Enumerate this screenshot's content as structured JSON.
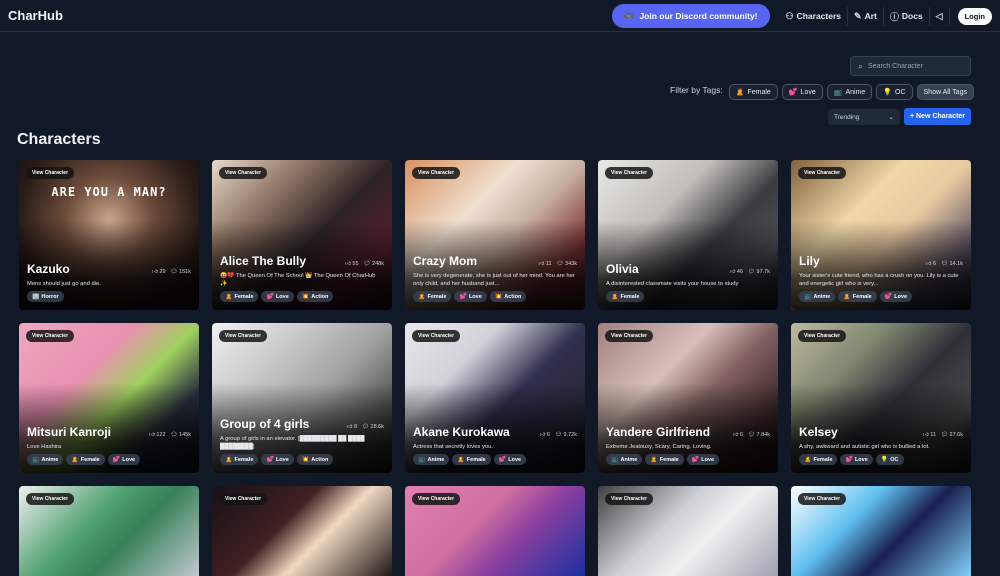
{
  "header": {
    "brand": "CharHub",
    "discord_label": "Join our Discord community!",
    "nav": [
      {
        "label": "Characters",
        "icon": "people-icon"
      },
      {
        "label": "Art",
        "icon": "brush-icon"
      },
      {
        "label": "Docs",
        "icon": "help-circle-icon"
      }
    ],
    "announce_icon": "megaphone-icon",
    "login_label": "Login"
  },
  "search": {
    "placeholder": "Search Character",
    "value": ""
  },
  "filters": {
    "label": "Filter by Tags:",
    "tags": [
      {
        "emoji": "🙎",
        "label": "Female"
      },
      {
        "emoji": "💕",
        "label": "Love"
      },
      {
        "emoji": "📺",
        "label": "Anime"
      },
      {
        "emoji": "💡",
        "label": "OC"
      }
    ],
    "show_all_label": "Show All Tags"
  },
  "sort": {
    "selected": "Trending"
  },
  "new_character_label": "+ New Character",
  "section_title": "Characters",
  "view_label": "View Character",
  "characters": [
    {
      "name": "Kazuko",
      "likes": "29",
      "chats": "151k",
      "overlay": "ARE YOU A MAN?",
      "desc": "Mens should just go and die.",
      "tags": [
        {
          "e": "🏢",
          "t": "Horror"
        }
      ],
      "bg": "radial-gradient(ellipse at 50% 40%, #c9a48a 0%, #6b4a3a 35%, #2a1c18 70%, #120c0a 100%)"
    },
    {
      "name": "Alice The Bully",
      "likes": "55",
      "chats": "248k",
      "desc": "😝💔 The Queen Of The School 👑 The Queen Of CharHub ✨",
      "tags": [
        {
          "e": "🙎",
          "t": "Female"
        },
        {
          "e": "💕",
          "t": "Love"
        },
        {
          "e": "💥",
          "t": "Action"
        }
      ],
      "bg": "linear-gradient(135deg, #e8d8c8 0%, #8a7060 30%, #2b2226 55%, #5a2030 80%, #1a1418 100%)"
    },
    {
      "name": "Crazy Mom",
      "likes": "11",
      "chats": "343k",
      "desc": "She is very degenerate, she is just out of her mind. You are her only child, and her husband just...",
      "tags": [
        {
          "e": "🙎",
          "t": "Female"
        },
        {
          "e": "💕",
          "t": "Love"
        },
        {
          "e": "💥",
          "t": "Action"
        }
      ],
      "bg": "linear-gradient(135deg, #d89060 0%, #f0e0d0 35%, #c8b0a0 55%, #7a3030 80%, #402020 100%)"
    },
    {
      "name": "Olivia",
      "likes": "46",
      "chats": "97.7k",
      "desc": "A disinterested classmate visits your house to study",
      "tags": [
        {
          "e": "🙎",
          "t": "Female"
        }
      ],
      "bg": "linear-gradient(135deg, #e8e8e4 0%, #c0beb8 35%, #3a3a40 60%, #505058 80%, #2a2a2e 100%)"
    },
    {
      "name": "Lily",
      "likes": "6",
      "chats": "14.1k",
      "desc": "Your sister's cute friend, who has a crush on you. Lily is a cute and energetic girl who is very...",
      "tags": [
        {
          "e": "📺",
          "t": "Anime"
        },
        {
          "e": "🙎",
          "t": "Female"
        },
        {
          "e": "💕",
          "t": "Love"
        }
      ],
      "bg": "linear-gradient(135deg, #806040 0%, #f0d8a8 35%, #e8c8a0 55%, #605868 80%, #282830 100%)"
    },
    {
      "name": "Mitsuri Kanroji",
      "likes": "122",
      "chats": "145k",
      "desc": "Love Hashira",
      "tags": [
        {
          "e": "📺",
          "t": "Anime"
        },
        {
          "e": "🙎",
          "t": "Female"
        },
        {
          "e": "💕",
          "t": "Love"
        }
      ],
      "bg": "linear-gradient(135deg, #f0a8c0 0%, #e890b0 35%, #a0d060 55%, #2a3040 75%, #101828 100%)"
    },
    {
      "name": "Group of 4 girls",
      "likes": "8",
      "chats": "28.6k",
      "desc": "A group of girls in an elevator. [█████████ ██ ████ ████████]",
      "tags": [
        {
          "e": "🙎",
          "t": "Female"
        },
        {
          "e": "💕",
          "t": "Love"
        },
        {
          "e": "💥",
          "t": "Action"
        }
      ],
      "bg": "linear-gradient(135deg, #f0f0f0 0%, #c8c8c8 30%, #a0a0a0 55%, #505050 80%, #202020 100%)"
    },
    {
      "name": "Akane Kurokawa",
      "likes": "6",
      "chats": "9.72k",
      "desc": "Actress that secretly loves you.",
      "tags": [
        {
          "e": "📺",
          "t": "Anime"
        },
        {
          "e": "🙎",
          "t": "Female"
        },
        {
          "e": "💕",
          "t": "Love"
        }
      ],
      "bg": "linear-gradient(135deg, #e8e8ec 0%, #d0d0d8 30%, #303050 55%, #282838 80%, #101018 100%)"
    },
    {
      "name": "Yandere Girlfriend",
      "likes": "6",
      "chats": "7.84k",
      "desc": "Extreme Jealousy, Scary, Caring, Loving.",
      "tags": [
        {
          "e": "📺",
          "t": "Anime"
        },
        {
          "e": "🙎",
          "t": "Female"
        },
        {
          "e": "💕",
          "t": "Love"
        }
      ],
      "bg": "linear-gradient(135deg, #a08080 0%, #d8c0b8 35%, #806060 55%, #402828 80%, #181010 100%)"
    },
    {
      "name": "Kelsey",
      "likes": "11",
      "chats": "27.6k",
      "desc": "A shy, awkward and autistic girl who is bullied a lot.",
      "tags": [
        {
          "e": "🙎",
          "t": "Female"
        },
        {
          "e": "💕",
          "t": "Love"
        },
        {
          "e": "💡",
          "t": "OC"
        }
      ],
      "bg": "linear-gradient(135deg, #c0b8a0 0%, #808870 30%, #303038 55%, #484848 80%, #1c1c1c 100%)"
    },
    {
      "bg": "linear-gradient(135deg, #f0f0f0 0%, #50a070 40%, #388058 60%, #c0c8d0 100%)"
    },
    {
      "bg": "linear-gradient(135deg, #181018 0%, #402020 40%, #f0d8c0 60%, #201818 100%)"
    },
    {
      "bg": "linear-gradient(135deg, #e080b0 0%, #d070a0 40%, #9040a0 60%, #1830a0 100%)"
    },
    {
      "bg": "linear-gradient(135deg, #404040 0%, #d0d0d8 40%, #f0f0f0 60%, #a0a0b0 100%)"
    },
    {
      "bg": "linear-gradient(135deg, #ffffff 0%, #60c0f0 35%, #1a2050 60%, #80d0f8 100%)"
    }
  ]
}
